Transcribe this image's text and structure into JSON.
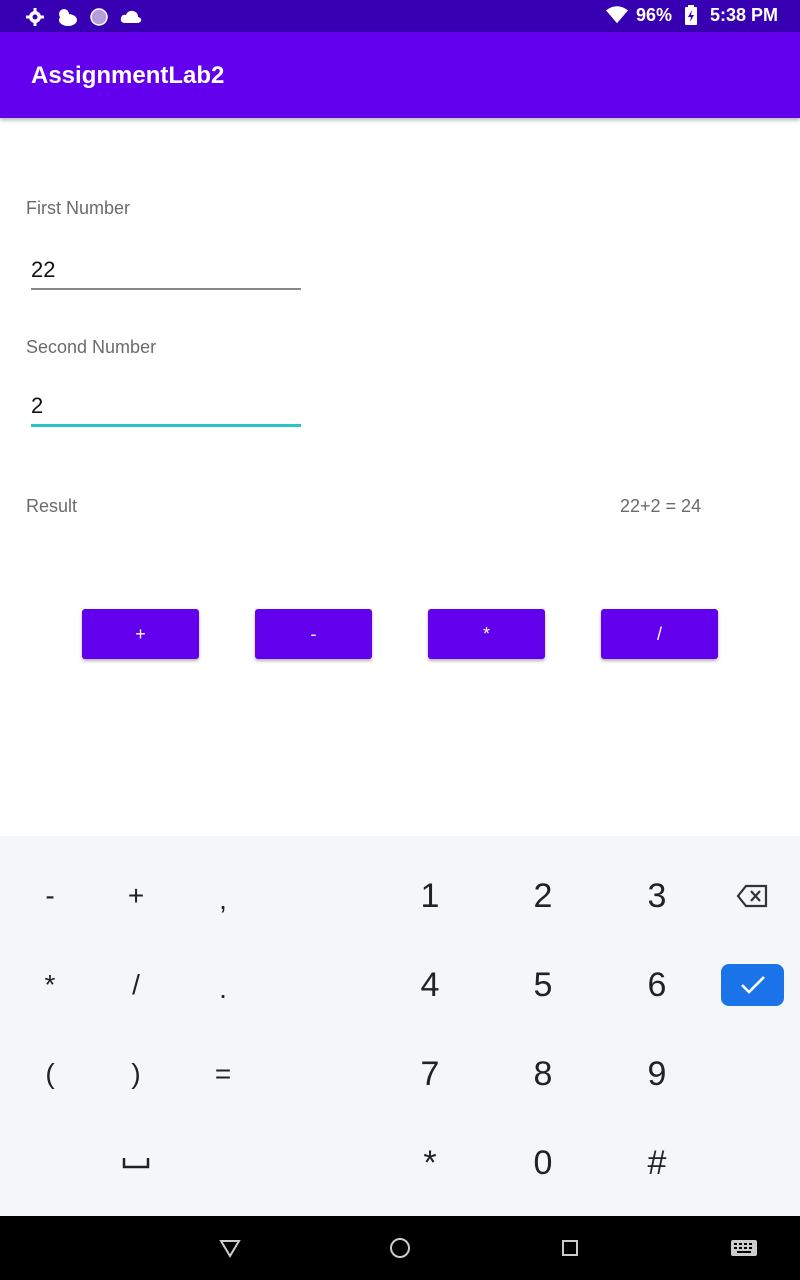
{
  "status_bar": {
    "battery": "96%",
    "time": "5:38 PM",
    "left_icons": [
      "settings-icon",
      "weather-cloud-sun-icon",
      "circle-icon",
      "cloud-icon"
    ],
    "right_icons": [
      "wifi-icon",
      "battery-icon"
    ]
  },
  "app": {
    "title": "AssignmentLab2",
    "accent": "#6200ee",
    "status_color": "#3700b3"
  },
  "form": {
    "first_label": "First Number",
    "first_value": "22",
    "second_label": "Second Number",
    "second_value": "2",
    "result_label": "Result",
    "result_value": "22+2 = 24"
  },
  "operations": [
    "+",
    "-",
    "*",
    "/"
  ],
  "keyboard": {
    "symbols": [
      [
        "-",
        "+",
        ","
      ],
      [
        "*",
        "/",
        "."
      ],
      [
        "(",
        ")",
        "="
      ]
    ],
    "digits": [
      [
        "1",
        "2",
        "3"
      ],
      [
        "4",
        "5",
        "6"
      ],
      [
        "7",
        "8",
        "9"
      ],
      [
        "*",
        "0",
        "#"
      ]
    ],
    "space_label": "␣"
  },
  "nav": [
    "back-icon",
    "home-icon",
    "recents-icon",
    "keyboard-icon"
  ]
}
